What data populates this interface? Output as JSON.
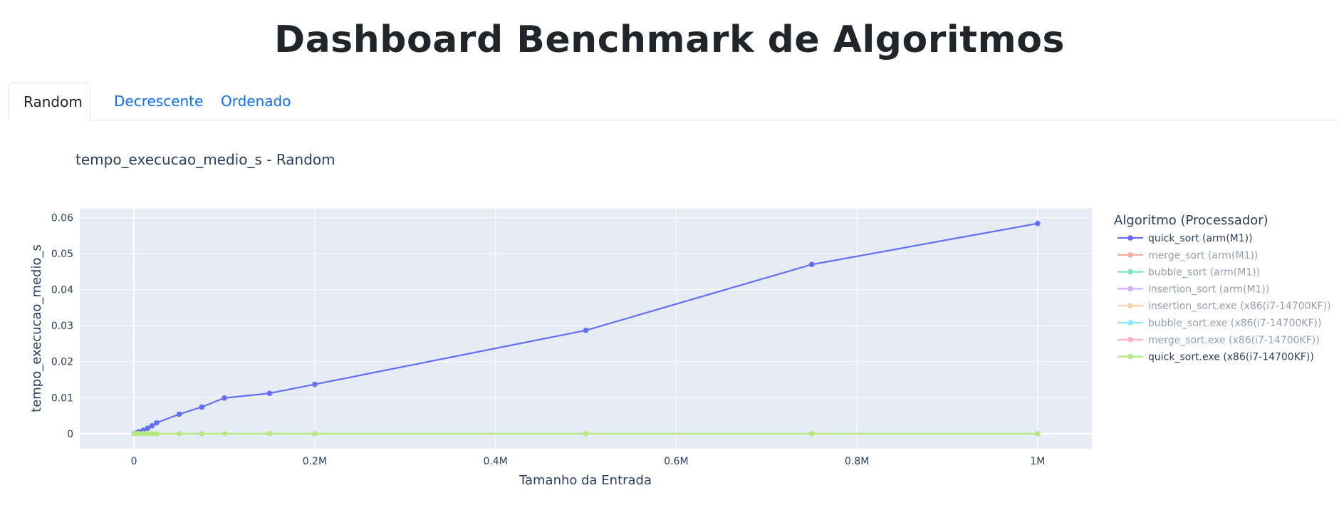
{
  "page": {
    "title": "Dashboard Benchmark de Algoritmos"
  },
  "tabs": [
    {
      "label": "Random",
      "active": true
    },
    {
      "label": "Decrescente",
      "active": false
    },
    {
      "label": "Ordenado",
      "active": false
    }
  ],
  "chart_data": {
    "type": "line",
    "title": "tempo_execucao_medio_s - Random",
    "xlabel": "Tamanho da Entrada",
    "ylabel": "tempo_execucao_medio_s",
    "xlim": [
      -60000,
      1060000
    ],
    "ylim": [
      -0.0042,
      0.0625
    ],
    "x_ticks": [
      {
        "value": 0,
        "label": "0"
      },
      {
        "value": 200000,
        "label": "0.2M"
      },
      {
        "value": 400000,
        "label": "0.4M"
      },
      {
        "value": 600000,
        "label": "0.6M"
      },
      {
        "value": 800000,
        "label": "0.8M"
      },
      {
        "value": 1000000,
        "label": "1M"
      }
    ],
    "y_ticks": [
      {
        "value": 0,
        "label": "0"
      },
      {
        "value": 0.01,
        "label": "0.01"
      },
      {
        "value": 0.02,
        "label": "0.02"
      },
      {
        "value": 0.03,
        "label": "0.03"
      },
      {
        "value": 0.04,
        "label": "0.04"
      },
      {
        "value": 0.05,
        "label": "0.05"
      },
      {
        "value": 0.06,
        "label": "0.06"
      }
    ],
    "grid": true,
    "background": "#e5ecf6",
    "legend": {
      "title": "Algoritmo (Processador)",
      "placement": "right"
    },
    "x": [
      100,
      1000,
      5000,
      10000,
      15000,
      20000,
      25000,
      50000,
      75000,
      100000,
      150000,
      200000,
      500000,
      750000,
      1000000
    ],
    "series": [
      {
        "name": "quick_sort (arm(M1))",
        "color": "#636efa",
        "visible": true,
        "values": [
          1e-05,
          9e-05,
          0.0005,
          0.0009,
          0.0015,
          0.0022,
          0.003,
          0.0054,
          0.0074,
          0.0099,
          0.0112,
          0.0137,
          0.0287,
          0.047,
          0.0584
        ]
      },
      {
        "name": "merge_sort (arm(M1))",
        "color": "#ef553b",
        "visible": false,
        "values": []
      },
      {
        "name": "bubble_sort (arm(M1))",
        "color": "#00cc96",
        "visible": false,
        "values": []
      },
      {
        "name": "insertion_sort (arm(M1))",
        "color": "#ab63fa",
        "visible": false,
        "values": []
      },
      {
        "name": "insertion_sort.exe (x86(i7-14700KF))",
        "color": "#ffa15a",
        "visible": false,
        "values": []
      },
      {
        "name": "bubble_sort.exe (x86(i7-14700KF))",
        "color": "#19d3f3",
        "visible": false,
        "values": []
      },
      {
        "name": "merge_sort.exe (x86(i7-14700KF))",
        "color": "#ff6692",
        "visible": false,
        "values": []
      },
      {
        "name": "quick_sort.exe (x86(i7-14700KF))",
        "color": "#b6e880",
        "visible": true,
        "values": [
          0,
          0,
          0,
          0,
          0,
          0,
          0,
          0,
          0,
          0,
          0,
          0,
          0,
          0,
          0
        ]
      }
    ]
  }
}
